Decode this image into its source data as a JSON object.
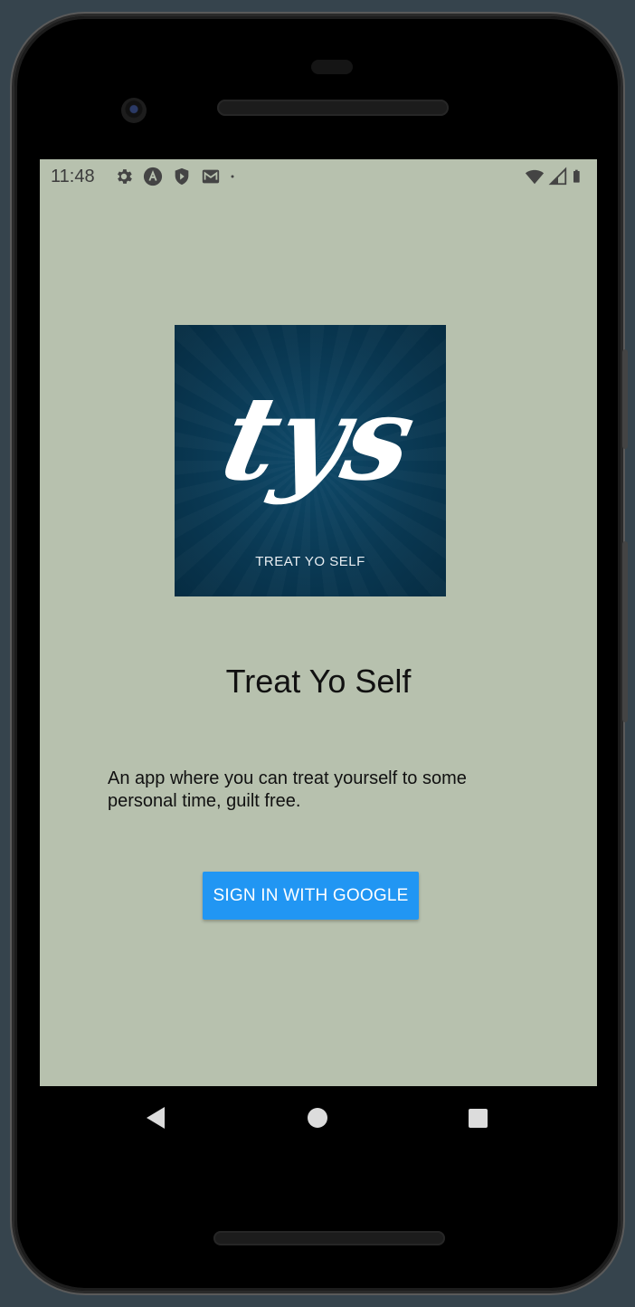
{
  "status_bar": {
    "time": "11:48",
    "left_icons": [
      "gear-icon",
      "app-logo-icon",
      "shield-icon",
      "mail-icon",
      "dot-icon"
    ],
    "right_icons": [
      "wifi-icon",
      "signal-icon",
      "battery-icon"
    ]
  },
  "app": {
    "logo_text": "tys",
    "logo_caption": "TREAT YO SELF",
    "title": "Treat Yo Self",
    "description": "An app where you can treat yourself to some personal time, guilt free.",
    "sign_in_label": "SIGN IN WITH GOOGLE"
  },
  "colors": {
    "background": "#b7c1ae",
    "button": "#2196f3",
    "logo_bg": "#093751"
  },
  "nav_bar": {
    "buttons": [
      "back-icon",
      "home-icon",
      "recents-icon"
    ]
  }
}
